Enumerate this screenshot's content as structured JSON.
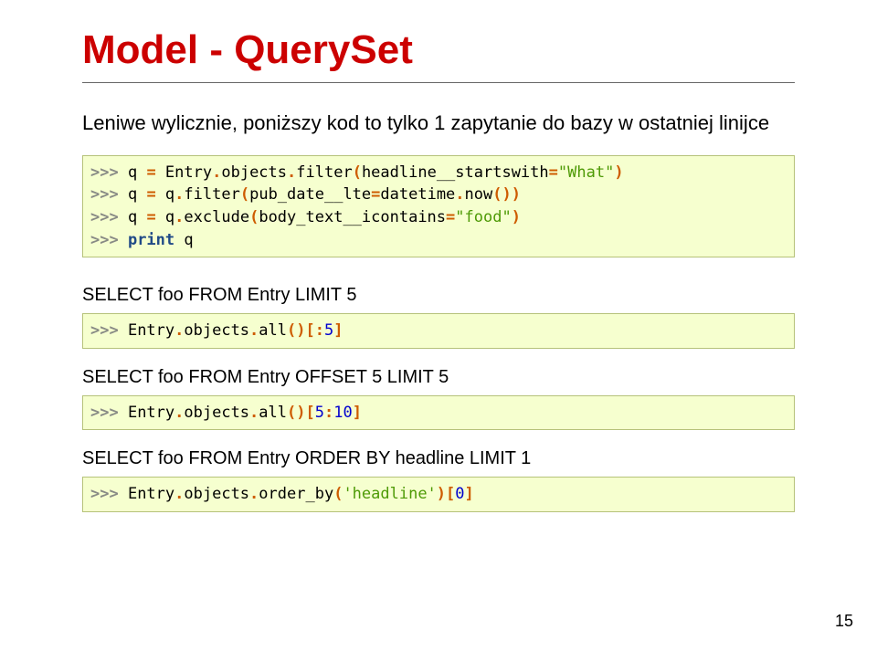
{
  "title": "Model - QuerySet",
  "intro": "Leniwe wylicznie, poniższy kod to tylko 1 zapytanie do bazy w ostatniej linijce",
  "sections": [
    {
      "label": null,
      "code": "block1"
    },
    {
      "label": "SELECT foo FROM Entry LIMIT 5",
      "code": "block2"
    },
    {
      "label": "SELECT foo FROM Entry OFFSET 5 LIMIT 5",
      "code": "block3"
    },
    {
      "label": "SELECT foo FROM Entry ORDER BY headline LIMIT 1",
      "code": "block4"
    }
  ],
  "code": {
    "block1": {
      "lines": [
        [
          {
            "c": "pr",
            "t": ">>> "
          },
          {
            "c": "id",
            "t": "q "
          },
          {
            "c": "op",
            "t": "="
          },
          {
            "c": "id",
            "t": " Entry"
          },
          {
            "c": "op",
            "t": "."
          },
          {
            "c": "id",
            "t": "objects"
          },
          {
            "c": "op",
            "t": "."
          },
          {
            "c": "id",
            "t": "filter"
          },
          {
            "c": "op",
            "t": "("
          },
          {
            "c": "id",
            "t": "headline__startswith"
          },
          {
            "c": "op",
            "t": "="
          },
          {
            "c": "s",
            "t": "\"What\""
          },
          {
            "c": "op",
            "t": ")"
          }
        ],
        [
          {
            "c": "pr",
            "t": ">>> "
          },
          {
            "c": "id",
            "t": "q "
          },
          {
            "c": "op",
            "t": "="
          },
          {
            "c": "id",
            "t": " q"
          },
          {
            "c": "op",
            "t": "."
          },
          {
            "c": "id",
            "t": "filter"
          },
          {
            "c": "op",
            "t": "("
          },
          {
            "c": "id",
            "t": "pub_date__lte"
          },
          {
            "c": "op",
            "t": "="
          },
          {
            "c": "id",
            "t": "datetime"
          },
          {
            "c": "op",
            "t": "."
          },
          {
            "c": "id",
            "t": "now"
          },
          {
            "c": "op",
            "t": "())"
          }
        ],
        [
          {
            "c": "pr",
            "t": ">>> "
          },
          {
            "c": "id",
            "t": "q "
          },
          {
            "c": "op",
            "t": "="
          },
          {
            "c": "id",
            "t": " q"
          },
          {
            "c": "op",
            "t": "."
          },
          {
            "c": "id",
            "t": "exclude"
          },
          {
            "c": "op",
            "t": "("
          },
          {
            "c": "id",
            "t": "body_text__icontains"
          },
          {
            "c": "op",
            "t": "="
          },
          {
            "c": "s",
            "t": "\"food\""
          },
          {
            "c": "op",
            "t": ")"
          }
        ],
        [
          {
            "c": "pr",
            "t": ">>> "
          },
          {
            "c": "k",
            "t": "print"
          },
          {
            "c": "id",
            "t": " q"
          }
        ]
      ]
    },
    "block2": {
      "lines": [
        [
          {
            "c": "pr",
            "t": ">>> "
          },
          {
            "c": "id",
            "t": "Entry"
          },
          {
            "c": "op",
            "t": "."
          },
          {
            "c": "id",
            "t": "objects"
          },
          {
            "c": "op",
            "t": "."
          },
          {
            "c": "id",
            "t": "all"
          },
          {
            "c": "op",
            "t": "()[:"
          },
          {
            "c": "num",
            "t": "5"
          },
          {
            "c": "op",
            "t": "]"
          }
        ]
      ]
    },
    "block3": {
      "lines": [
        [
          {
            "c": "pr",
            "t": ">>> "
          },
          {
            "c": "id",
            "t": "Entry"
          },
          {
            "c": "op",
            "t": "."
          },
          {
            "c": "id",
            "t": "objects"
          },
          {
            "c": "op",
            "t": "."
          },
          {
            "c": "id",
            "t": "all"
          },
          {
            "c": "op",
            "t": "()["
          },
          {
            "c": "num",
            "t": "5"
          },
          {
            "c": "op",
            "t": ":"
          },
          {
            "c": "num",
            "t": "10"
          },
          {
            "c": "op",
            "t": "]"
          }
        ]
      ]
    },
    "block4": {
      "lines": [
        [
          {
            "c": "pr",
            "t": ">>> "
          },
          {
            "c": "id",
            "t": "Entry"
          },
          {
            "c": "op",
            "t": "."
          },
          {
            "c": "id",
            "t": "objects"
          },
          {
            "c": "op",
            "t": "."
          },
          {
            "c": "id",
            "t": "order_by"
          },
          {
            "c": "op",
            "t": "("
          },
          {
            "c": "s",
            "t": "'headline'"
          },
          {
            "c": "op",
            "t": ")["
          },
          {
            "c": "num",
            "t": "0"
          },
          {
            "c": "op",
            "t": "]"
          }
        ]
      ]
    }
  },
  "page_number": "15"
}
